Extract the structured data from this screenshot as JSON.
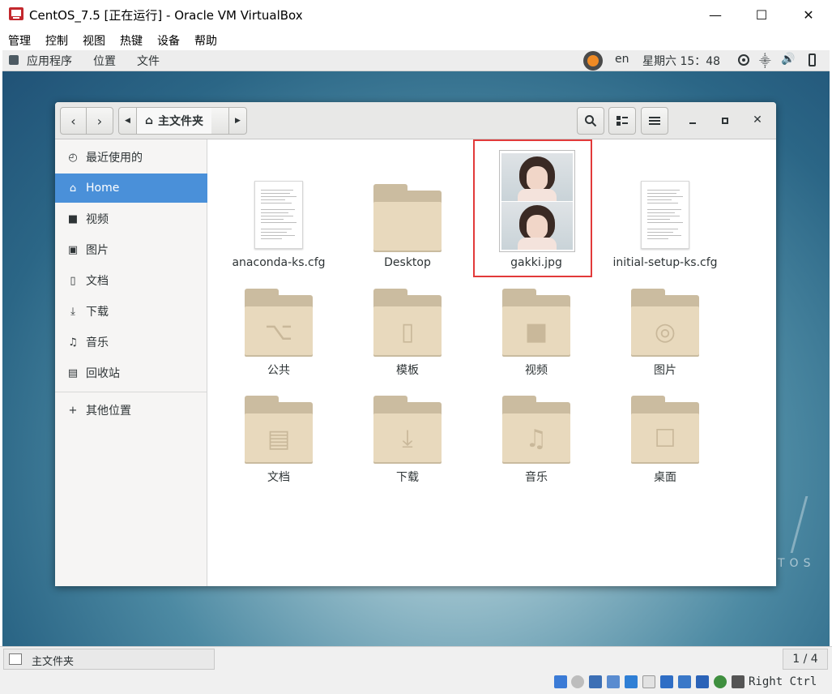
{
  "window": {
    "title": "CentOS_7.5 [正在运行] - Oracle VM VirtualBox",
    "min_glyph": "—",
    "max_glyph": "☐",
    "close_glyph": "✕"
  },
  "host_menu": [
    "管理",
    "控制",
    "视图",
    "热键",
    "设备",
    "帮助"
  ],
  "gnome_panel": {
    "applications": "应用程序",
    "places": "位置",
    "files": "文件",
    "lang": "en",
    "clock": "星期六 15：48"
  },
  "nautilus": {
    "path_home_label": "主文件夹",
    "sidebar": [
      {
        "label": "最近使用的",
        "icon": "clock-icon"
      },
      {
        "label": "Home",
        "icon": "home-icon",
        "selected": true
      },
      {
        "label": "视频",
        "icon": "video-icon"
      },
      {
        "label": "图片",
        "icon": "camera-icon"
      },
      {
        "label": "文档",
        "icon": "document-icon"
      },
      {
        "label": "下载",
        "icon": "download-icon"
      },
      {
        "label": "音乐",
        "icon": "music-icon"
      },
      {
        "label": "回收站",
        "icon": "trash-icon"
      }
    ],
    "other_locations": "其他位置",
    "files": [
      {
        "name": "anaconda-ks.cfg",
        "type": "text"
      },
      {
        "name": "Desktop",
        "type": "folder"
      },
      {
        "name": "gakki.jpg",
        "type": "image",
        "highlighted": true
      },
      {
        "name": "initial-setup-ks.cfg",
        "type": "text"
      },
      {
        "name": "公共",
        "type": "folder",
        "emblem": "share"
      },
      {
        "name": "模板",
        "type": "folder",
        "emblem": "template"
      },
      {
        "name": "视频",
        "type": "folder",
        "emblem": "video"
      },
      {
        "name": "图片",
        "type": "folder",
        "emblem": "camera"
      },
      {
        "name": "文档",
        "type": "folder",
        "emblem": "document"
      },
      {
        "name": "下载",
        "type": "folder",
        "emblem": "download"
      },
      {
        "name": "音乐",
        "type": "folder",
        "emblem": "music"
      },
      {
        "name": "桌面",
        "type": "folder",
        "emblem": "desktop"
      }
    ]
  },
  "desktop_watermark": "TOS",
  "statusbar": {
    "location": "主文件夹",
    "page": "1 / 4"
  },
  "host_key": "Right Ctrl",
  "colors": {
    "accent": "#4a90d9",
    "highlight_box": "#e23a3a",
    "folder": "#e8d9bd"
  }
}
